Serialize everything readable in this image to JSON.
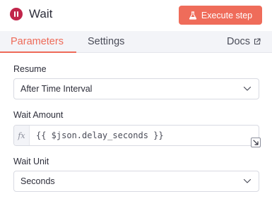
{
  "header": {
    "node_icon": "pause-circle-icon",
    "title": "Wait",
    "execute_label": "Execute step",
    "execute_icon": "flask-icon",
    "accent_color": "#ef6c5a"
  },
  "tabs": {
    "parameters": "Parameters",
    "settings": "Settings",
    "docs": "Docs",
    "docs_icon": "external-link-icon",
    "active": "Parameters"
  },
  "fields": {
    "resume": {
      "label": "Resume",
      "value": "After Time Interval"
    },
    "wait_amount": {
      "label": "Wait Amount",
      "expression_prefix": "fx",
      "value": "{{ $json.delay_seconds }}"
    },
    "wait_unit": {
      "label": "Wait Unit",
      "value": "Seconds"
    }
  }
}
